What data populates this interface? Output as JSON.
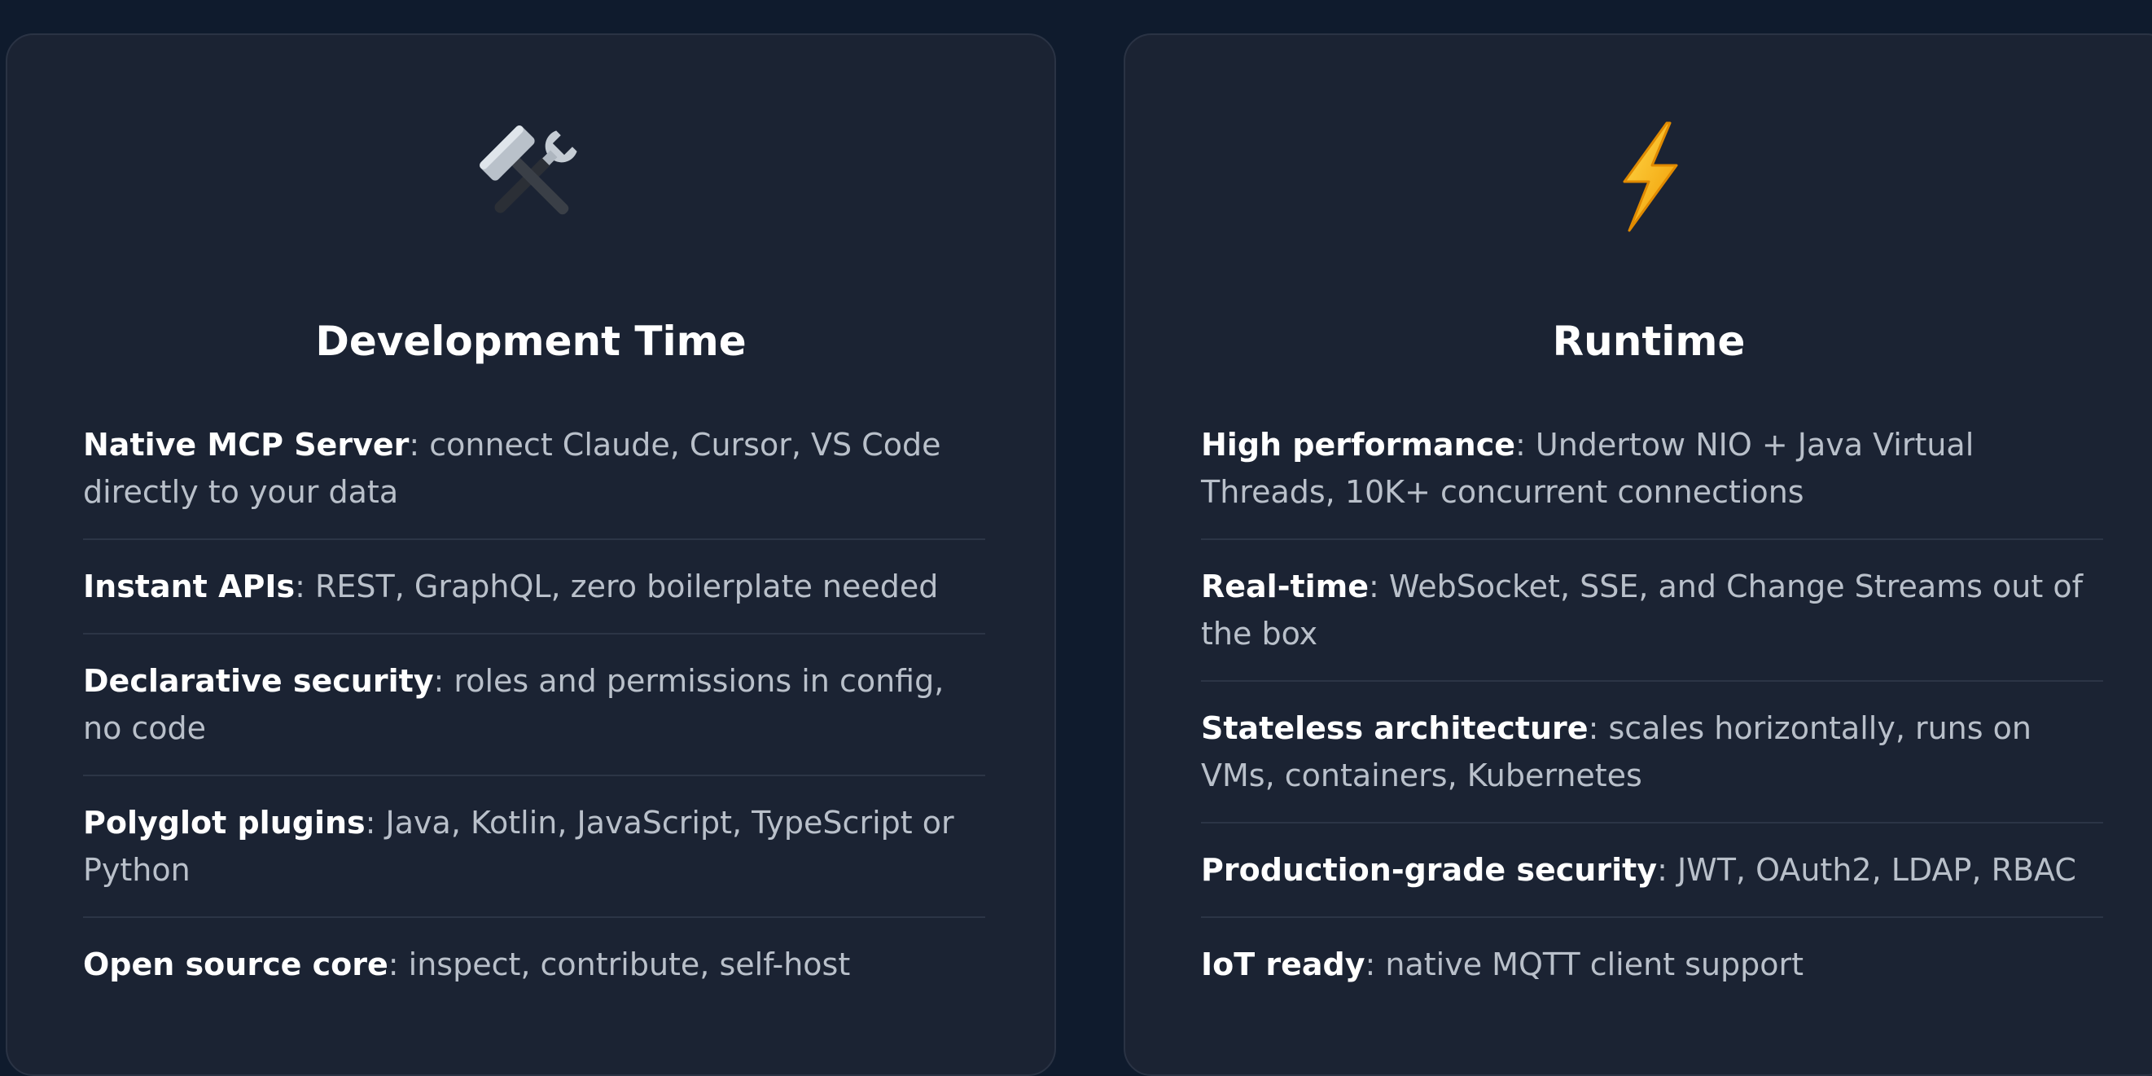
{
  "cards": [
    {
      "icon": "hammer-and-wrench-icon",
      "title": "Development Time",
      "features": [
        {
          "name": "Native MCP Server",
          "text": ": connect Claude, Cursor, VS Code directly to your data"
        },
        {
          "name": "Instant APIs",
          "text": ": REST, GraphQL, zero boilerplate needed"
        },
        {
          "name": "Declarative security",
          "text": ": roles and permissions in config, no code"
        },
        {
          "name": "Polyglot plugins",
          "text": ": Java, Kotlin, JavaScript, TypeScript or Python"
        },
        {
          "name": "Open source core",
          "text": ": inspect, contribute, self-host"
        }
      ]
    },
    {
      "icon": "lightning-bolt-icon",
      "title": "Runtime",
      "features": [
        {
          "name": "High performance",
          "text": ": Undertow NIO + Java Virtual Threads, 10K+ concurrent connections"
        },
        {
          "name": "Real-time",
          "text": ": WebSocket, SSE, and Change Streams out of the box"
        },
        {
          "name": "Stateless architecture",
          "text": ": scales horizontally, runs on VMs, containers, Kubernetes"
        },
        {
          "name": "Production-grade security",
          "text": ": JWT, OAuth2, LDAP, RBAC"
        },
        {
          "name": "IoT ready",
          "text": ": native MQTT client support"
        }
      ]
    }
  ],
  "colors": {
    "background": "#0f1b2d",
    "card": "#1b2333",
    "bolt": "#f5b800"
  }
}
